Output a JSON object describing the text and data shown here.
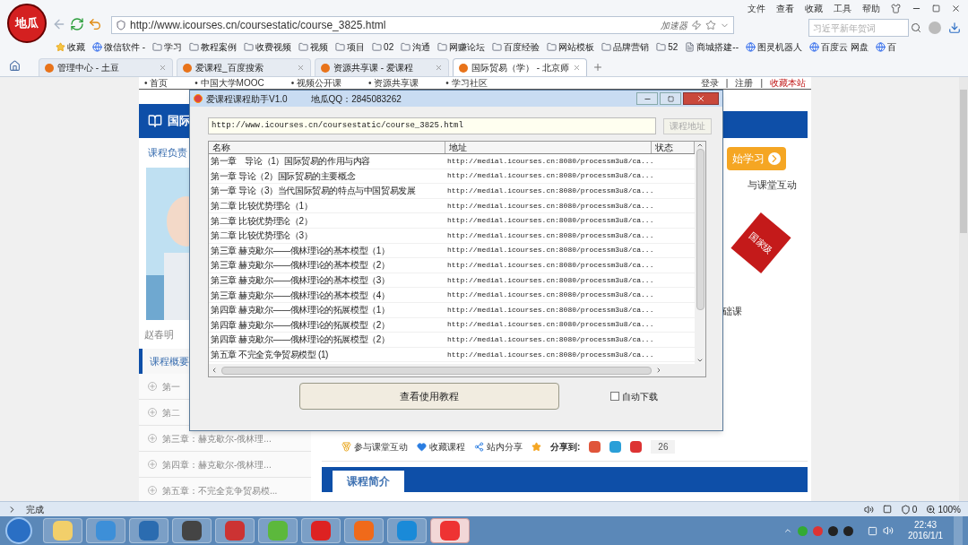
{
  "browser": {
    "logo": "地瓜",
    "menu": [
      "文件",
      "查看",
      "收藏",
      "工具",
      "帮助"
    ],
    "address": "http://www.icourses.cn/coursestatic/course_3825.html",
    "accelerator": "加速器",
    "search_placeholder": "习近平新年贺词",
    "bookmarks": [
      {
        "label": "收藏",
        "kind": "star"
      },
      {
        "label": "微信软件 -",
        "kind": "app"
      },
      {
        "label": "学习",
        "kind": "folder"
      },
      {
        "label": "教程案例",
        "kind": "folder"
      },
      {
        "label": "收费视频",
        "kind": "folder"
      },
      {
        "label": "视频",
        "kind": "folder"
      },
      {
        "label": "项目",
        "kind": "folder"
      },
      {
        "label": "02",
        "kind": "folder"
      },
      {
        "label": "沟通",
        "kind": "folder"
      },
      {
        "label": "网赚论坛",
        "kind": "folder"
      },
      {
        "label": "百度经验",
        "kind": "folder"
      },
      {
        "label": "网站模板",
        "kind": "folder"
      },
      {
        "label": "品牌营销",
        "kind": "folder"
      },
      {
        "label": "52",
        "kind": "folder"
      },
      {
        "label": "商城搭建--",
        "kind": "page"
      },
      {
        "label": "图灵机器人",
        "kind": "app"
      },
      {
        "label": "百度云 网盘",
        "kind": "app"
      },
      {
        "label": "百",
        "kind": "app"
      }
    ],
    "tabs": [
      {
        "label": "管理中心 - 土豆",
        "selected": false
      },
      {
        "label": "爱课程_百度搜索",
        "selected": false
      },
      {
        "label": "资源共享课 - 爱课程",
        "selected": false
      },
      {
        "label": "国际贸易（学） - 北京师",
        "selected": true
      }
    ]
  },
  "page": {
    "nav": [
      "• 首页",
      "• 中国大学MOOC",
      "• 视频公开课",
      "• 资源共享课",
      "• 学习社区"
    ],
    "account": [
      "登录",
      "注册",
      "收藏本站"
    ],
    "account_separator": "|",
    "course_title": "国际",
    "leader_label": "课程负责",
    "teacher": "赵春明",
    "overview": "课程概要",
    "chapters": [
      "第一",
      "第二",
      "第三章：赫克歇尔-俄林理...",
      "第四章：赫克歇尔-俄林理...",
      "第五章：不完全竞争贸易模..."
    ],
    "start_button": "始学习",
    "interaction_text": "与课堂互动",
    "ribbon": "国家级",
    "course_type": "础课",
    "actions": [
      "参与课堂互动",
      "收藏课程",
      "站内分享"
    ],
    "share_label": "分享到:",
    "share_count": "26",
    "intro_tab": "课程简介"
  },
  "dialog": {
    "title": "爱课程课程助手V1.0",
    "qq": "地瓜QQ：2845083262",
    "url": "http://www.icourses.cn/coursestatic/course_3825.html",
    "url_button": "课程地址",
    "columns": [
      "名称",
      "地址",
      "状态"
    ],
    "rows": [
      {
        "name": "第一章　导论（1）国际贸易的作用与内容",
        "address": "http://medial.icourses.cn:8080/processm3u8/ca..."
      },
      {
        "name": "第一章 导论（2）国际贸易的主要概念",
        "address": "http://medial.icourses.cn:8080/processm3u8/ca..."
      },
      {
        "name": "第一章 导论（3）当代国际贸易的特点与中国贸易发展",
        "address": "http://medial.icourses.cn:8080/processm3u8/ca..."
      },
      {
        "name": "第二章 比较优势理论（1）",
        "address": "http://medial.icourses.cn:8080/processm3u8/ca..."
      },
      {
        "name": "第二章 比较优势理论（2）",
        "address": "http://medial.icourses.cn:8080/processm3u8/ca..."
      },
      {
        "name": "第二章 比较优势理论（3）",
        "address": "http://medial.icourses.cn:8080/processm3u8/ca..."
      },
      {
        "name": "第三章 赫克歇尔——俄林理论的基本模型（1）",
        "address": "http://medial.icourses.cn:8080/processm3u8/ca..."
      },
      {
        "name": "第三章 赫克歇尔——俄林理论的基本模型（2）",
        "address": "http://medial.icourses.cn:8080/processm3u8/ca..."
      },
      {
        "name": "第三章 赫克歇尔——俄林理论的基本模型（3）",
        "address": "http://medial.icourses.cn:8080/processm3u8/ca..."
      },
      {
        "name": "第三章 赫克歇尔——俄林理论的基本模型（4）",
        "address": "http://medial.icourses.cn:8080/processm3u8/ca..."
      },
      {
        "name": "第四章 赫克歇尔——俄林理论的拓展模型（1）",
        "address": "http://medial.icourses.cn:8080/processm3u8/ca..."
      },
      {
        "name": "第四章 赫克歇尔——俄林理论的拓展模型（2）",
        "address": "http://medial.icourses.cn:8080/processm3u8/ca..."
      },
      {
        "name": "第四章 赫克歇尔——俄林理论的拓展模型（2）",
        "address": "http://medial.icourses.cn:8080/processm3u8/ca..."
      },
      {
        "name": "第五章 不完全竞争贸易模型 (1)",
        "address": "http://medial.icourses.cn:8080/processm3u8/ca..."
      }
    ],
    "tutorial_button": "查看使用教程",
    "auto_download": {
      "label": "自动下载",
      "checked": false
    }
  },
  "status_bar": {
    "text": "完成",
    "shield_count": "0",
    "zoom": "100%"
  },
  "taskbar": {
    "time": "22:43",
    "date": "2016/1/1"
  }
}
